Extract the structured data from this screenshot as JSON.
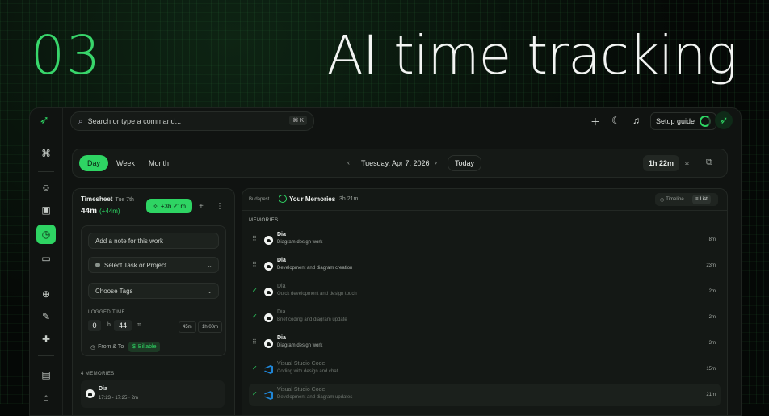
{
  "hero": {
    "number": "03",
    "title": "AI time tracking"
  },
  "topbar": {
    "search_placeholder": "Search or type a command...",
    "shortcut": "⌘ K",
    "setup_label": "Setup guide"
  },
  "datebar": {
    "tabs": [
      "Day",
      "Week",
      "Month"
    ],
    "active_tab": "Day",
    "date": "Tuesday, Apr 7, 2026",
    "today": "Today",
    "total": "1h 22m"
  },
  "timesheet": {
    "title": "Timesheet",
    "date": "Tue 7th",
    "duration": "44m",
    "delta": "(+44m)",
    "add_pill": "+3h 21m",
    "note_placeholder": "Add a note for this work",
    "task_placeholder": "Select Task or Project",
    "tags_placeholder": "Choose Tags",
    "logged_caption": "LOGGED TIME",
    "hours": "0",
    "hours_unit": "h",
    "minutes": "44",
    "minutes_unit": "m",
    "quick": [
      "45m",
      "1h 00m"
    ],
    "from_to": "From & To",
    "billable": "Billable",
    "memories_caption": "4 MEMORIES",
    "memory": {
      "name": "Dia",
      "time": "17:23 - 17:25 · 2m"
    }
  },
  "memories": {
    "location": "Budapest",
    "title": "Your Memories",
    "duration": "3h 21m",
    "views": [
      "Timeline",
      "List"
    ],
    "active_view": "List",
    "section": "MEMORIES",
    "items": [
      {
        "app": "Dia",
        "desc": "Diagram design work",
        "dur": "8m",
        "state": "active"
      },
      {
        "app": "Dia",
        "desc": "Development and diagram creation",
        "dur": "23m",
        "state": "active"
      },
      {
        "app": "Dia",
        "desc": "Quick development and design touch",
        "dur": "2m",
        "state": "logged"
      },
      {
        "app": "Dia",
        "desc": "Brief coding and diagram update",
        "dur": "2m",
        "state": "logged"
      },
      {
        "app": "Dia",
        "desc": "Diagram design work",
        "dur": "3m",
        "state": "active"
      },
      {
        "app": "Visual Studio Code",
        "desc": "Coding with design and chat",
        "dur": "15m",
        "state": "logged"
      },
      {
        "app": "Visual Studio Code",
        "desc": "Development and diagram updates",
        "dur": "21m",
        "state": "logged"
      }
    ]
  },
  "colors": {
    "accent": "#2ed463",
    "bg": "#050806",
    "panel": "#141815"
  }
}
